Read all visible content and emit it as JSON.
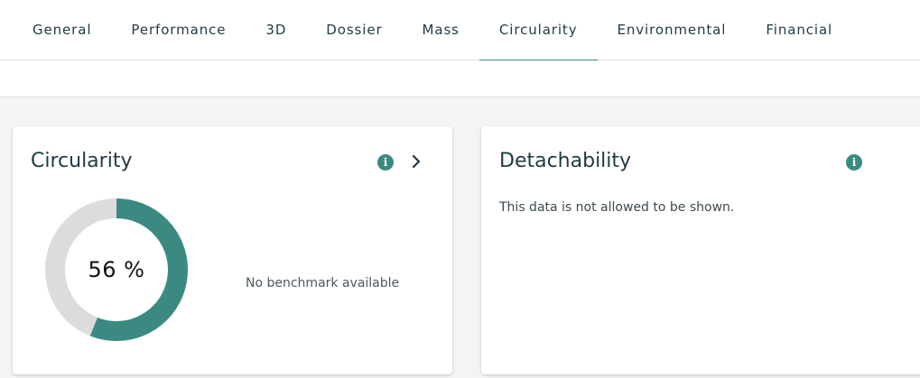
{
  "tabs": [
    {
      "label": "General"
    },
    {
      "label": "Performance"
    },
    {
      "label": "3D"
    },
    {
      "label": "Dossier"
    },
    {
      "label": "Mass"
    },
    {
      "label": "Circularity",
      "active": true
    },
    {
      "label": "Environmental"
    },
    {
      "label": "Financial"
    }
  ],
  "circularity_card": {
    "title": "Circularity",
    "value_text": "56 %",
    "value_fraction": 0.56,
    "benchmark_text": "No benchmark available",
    "info_icon": "info-icon",
    "chevron_icon": "chevron-right-icon"
  },
  "detachability_card": {
    "title": "Detachability",
    "message": "This data is not allowed to be shown.",
    "info_icon": "info-icon"
  },
  "colors": {
    "accent": "#3a8a82",
    "donut_track": "#dcdcdc",
    "text": "#1f3a44"
  }
}
